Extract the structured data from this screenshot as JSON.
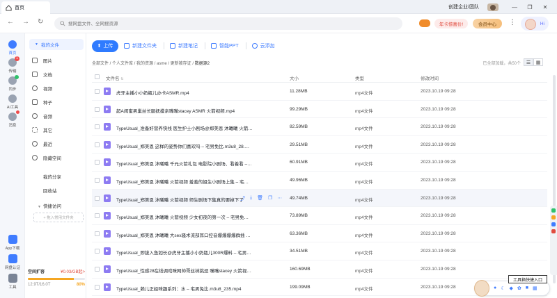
{
  "tabbar": {
    "tab_label": "首页",
    "create_org": "创建企业/团队"
  },
  "navbar": {
    "search_placeholder": "搜网盘文件、全网搜资源",
    "promo_label": "年卡惊喜价!",
    "vip_label": "会员中心",
    "mascot_label": "Hi"
  },
  "rail": {
    "items": [
      {
        "label": "首页"
      },
      {
        "label": "传输",
        "badge": "1"
      },
      {
        "label": "同步"
      },
      {
        "label": "AI工具"
      },
      {
        "label": "消息"
      }
    ],
    "bottom": [
      {
        "label": "App下载"
      },
      {
        "label": "网盘认证"
      },
      {
        "label": "工具"
      }
    ]
  },
  "sidebar": {
    "my_files": "我的文件",
    "items": [
      "图片",
      "文档",
      "视频",
      "种子",
      "音频",
      "其它",
      "最近",
      "隐藏空间"
    ],
    "my_share": "我的分享",
    "recycle": "回收站",
    "quick_access": "快捷访问",
    "add_quick": "+ 拖入常用文件夹",
    "storage": {
      "expand_label": "空间扩容",
      "price": "¥0.03/GB起>",
      "used": "12.9T/16.0T",
      "percent_text": "80%",
      "percent": 0.8
    }
  },
  "toolbar": {
    "upload": "上传",
    "new_folder": "新建文件夹",
    "new_note": "新建笔记",
    "smart_ppt": "智能PPT",
    "cloud_add": "云添加"
  },
  "breadcrumb": {
    "path": "全部文件 / 个人文件库 / 我的资源 / asme / 更新被存证 / ",
    "current": "数据源2",
    "loaded": "已全部加载，共50个"
  },
  "table": {
    "headers": {
      "name": "文件名",
      "size": "大小",
      "type": "类型",
      "date": "修改时间"
    },
    "rows": [
      {
        "name": "虎牙主播小小奶瓶儿办卡ASMR.mp4",
        "size": "11.28MB",
        "type": "mp4文件",
        "date": "2023.10.19 09:28"
      },
      {
        "name": "超A闺蜜男巢丝长腿抚摸亲嘴嘴stacey ASMR 火箭视频.mp4",
        "size": "99.29MB",
        "type": "mp4文件",
        "date": "2023.10.19 09:28"
      },
      {
        "name": "TypeUsual_准备好营养快线 医生护士小剧场@郑美恩 沐曦曦 火箭爆料 –...",
        "size": "82.59MB",
        "type": "mp4文件",
        "date": "2023.10.19 09:28"
      },
      {
        "name": "TypeUsual_郑美恩 这样的姿势你们喜欢吗 – 宅男免比.m3u8_28.mp4",
        "size": "29.51MB",
        "type": "mp4文件",
        "date": "2023.10.19 09:28"
      },
      {
        "name": "TypeUsual_郑美恩 沐曦曦 千元火箭礼包 电影院小剧场、看着看 – 宅男...",
        "size": "60.91MB",
        "type": "mp4文件",
        "date": "2023.10.19 09:28"
      },
      {
        "name": "TypeUsual_郑美恩 沐曦曦 火箭视频 羞羞的姐生小剧场上集 – 宅男免比...",
        "size": "49.96MB",
        "type": "mp4文件",
        "date": "2023.10.19 09:28"
      },
      {
        "name": "TypeUsual_郑美恩 沐曦曦 火箭视频 师生剧场下集真的要掉下了",
        "size": "49.74MB",
        "type": "mp4文件",
        "date": "2023.10.19 09:28"
      },
      {
        "name": "TypeUsual_郑美恩 沐曦曦 火箭视频 少女初夜的第一次 – 宅男免比.m3u...",
        "size": "73.89MB",
        "type": "mp4文件",
        "date": "2023.10.19 09:28"
      },
      {
        "name": "TypeUsual_郑美恩 沐曦曦 大sex骚术流部耳口控音爆爆爆爆群插 – 宅男...",
        "size": "63.36MB",
        "type": "mp4文件",
        "date": "2023.10.19 09:28"
      },
      {
        "name": "TypeUsual_即拔入鱼如长@虎牙主播小小奶瓶儿300R爆料 – 宅男免比...",
        "size": "34.51MB",
        "type": "mp4文件",
        "date": "2023.10.19 09:28"
      },
      {
        "name": "TypeUsual_性感28在线调戏咪网帅哥丝袜挑逗 嘴嘴stacey 火箭视频 –...",
        "size": "160.69MB",
        "type": "mp4文件",
        "date": "2023.10.19 09:28"
      },
      {
        "name": "TypeUsual_赖儿正经味趣系列：水 – 宅男免比.m3u8_235.mp4",
        "size": "199.09MB",
        "type": "mp4文件",
        "date": "2023.10.19 09:28"
      }
    ]
  },
  "helper": {
    "tooltip": "工具箱快捷入口"
  }
}
